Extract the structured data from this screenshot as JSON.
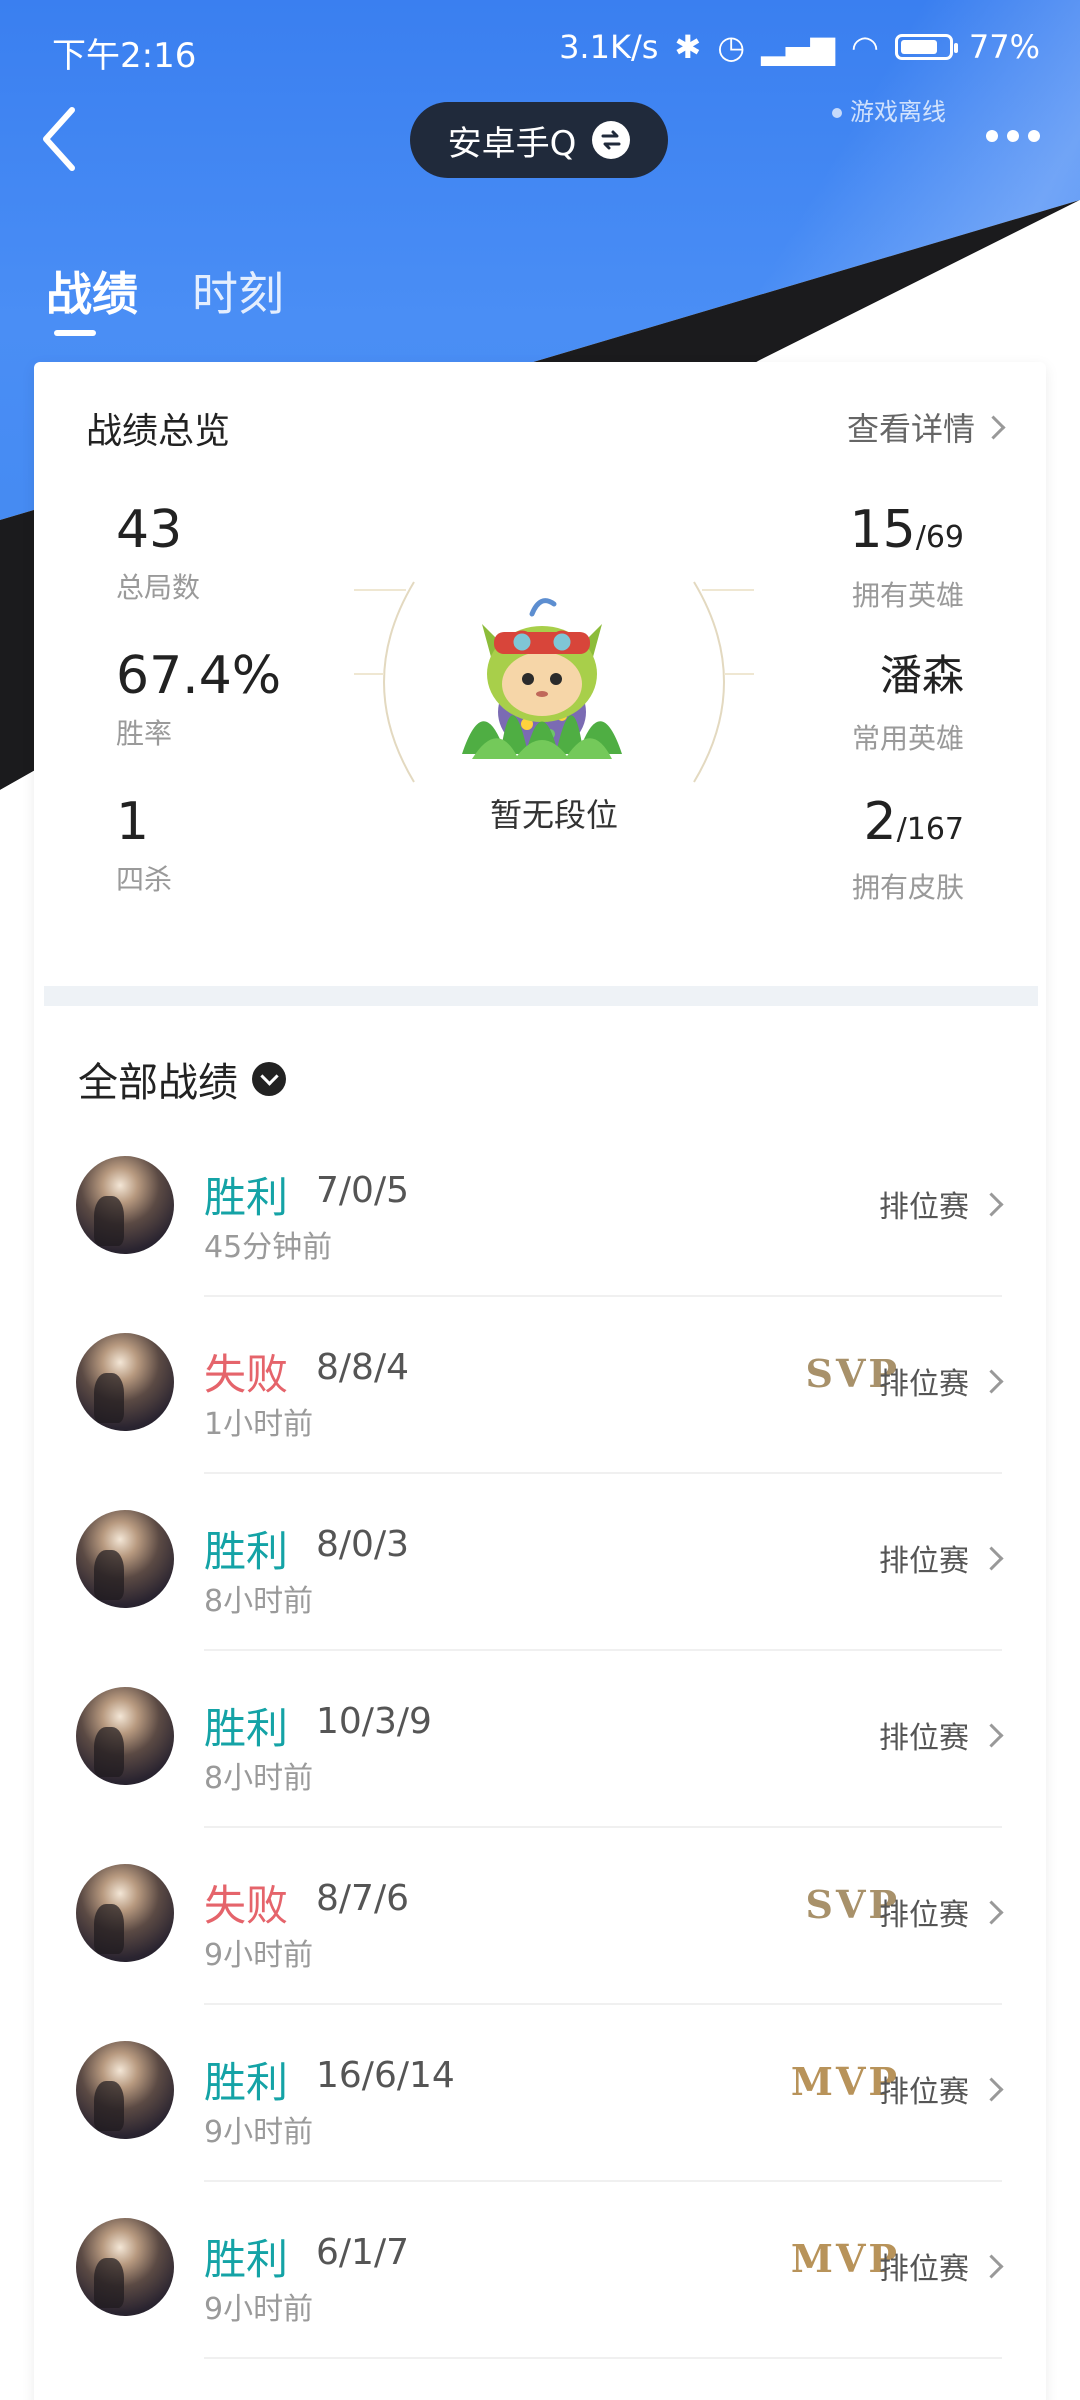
{
  "status_bar": {
    "time": "下午2:16",
    "net_speed": "3.1K/s",
    "battery": "77%",
    "game_status": "游戏离线"
  },
  "nav": {
    "account": "安卓手Q"
  },
  "tabs": [
    {
      "label": "战绩",
      "active": true
    },
    {
      "label": "时刻",
      "active": false
    }
  ],
  "overview": {
    "title": "战绩总览",
    "detail_link": "查看详情",
    "rank_label": "暂无段位",
    "stats_left": [
      {
        "value": "43",
        "label": "总局数"
      },
      {
        "value": "67.4%",
        "label": "胜率"
      },
      {
        "value": "1",
        "label": "四杀"
      }
    ],
    "stats_right": [
      {
        "value": "15",
        "of": "/69",
        "label": "拥有英雄"
      },
      {
        "value": "潘森",
        "of": "",
        "label": "常用英雄"
      },
      {
        "value": "2",
        "of": "/167",
        "label": "拥有皮肤"
      }
    ]
  },
  "matches": {
    "header": "全部战绩",
    "items": [
      {
        "result": "胜利",
        "outcome": "win",
        "kda": "7/0/5",
        "time": "45分钟前",
        "badge": "",
        "mode": "排位赛"
      },
      {
        "result": "失败",
        "outcome": "lose",
        "kda": "8/8/4",
        "time": "1小时前",
        "badge": "SVP",
        "mode": "排位赛"
      },
      {
        "result": "胜利",
        "outcome": "win",
        "kda": "8/0/3",
        "time": "8小时前",
        "badge": "",
        "mode": "排位赛"
      },
      {
        "result": "胜利",
        "outcome": "win",
        "kda": "10/3/9",
        "time": "8小时前",
        "badge": "",
        "mode": "排位赛"
      },
      {
        "result": "失败",
        "outcome": "lose",
        "kda": "8/7/6",
        "time": "9小时前",
        "badge": "SVP",
        "mode": "排位赛"
      },
      {
        "result": "胜利",
        "outcome": "win",
        "kda": "16/6/14",
        "time": "9小时前",
        "badge": "MVP",
        "mode": "排位赛"
      },
      {
        "result": "胜利",
        "outcome": "win",
        "kda": "6/1/7",
        "time": "9小时前",
        "badge": "MVP",
        "mode": "排位赛"
      }
    ]
  },
  "colors": {
    "win": "#14a3a6",
    "lose": "#e5646b",
    "header_blue": "#3a7ff0",
    "pill": "#202a3b"
  }
}
